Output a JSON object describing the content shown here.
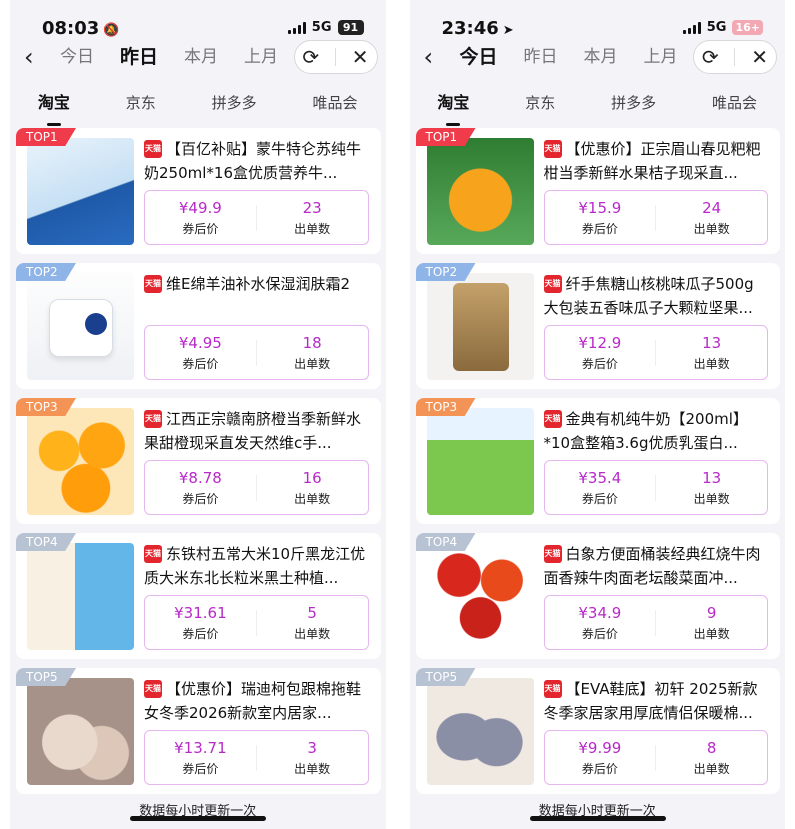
{
  "panels": [
    {
      "status": {
        "time": "08:03",
        "time_icon": "🔕",
        "network": "5G",
        "battery": "91",
        "battery_style": "dark"
      },
      "date_tabs": [
        "今日",
        "昨日",
        "本月",
        "上月"
      ],
      "active_date_tab": 1,
      "platform_tabs": [
        "淘宝",
        "京东",
        "拼多多",
        "唯品会"
      ],
      "active_platform_tab": 0,
      "items": [
        {
          "rank": "TOP1",
          "title": "【百亿补贴】蒙牛特仑苏纯牛奶250ml*16盒优质营养牛...",
          "price": "¥49.9",
          "price_label": "券后价",
          "orders": "23",
          "orders_label": "出单数",
          "image": "milk"
        },
        {
          "rank": "TOP2",
          "title": "维E绵羊油补水保湿润肤霜2",
          "price": "¥4.95",
          "price_label": "券后价",
          "orders": "18",
          "orders_label": "出单数",
          "image": "cream"
        },
        {
          "rank": "TOP3",
          "title": "江西正宗赣南脐橙当季新鲜水果甜橙现采直发天然维c手...",
          "price": "¥8.78",
          "price_label": "券后价",
          "orders": "16",
          "orders_label": "出单数",
          "image": "orange"
        },
        {
          "rank": "TOP4",
          "title": "东铁村五常大米10斤黑龙江优质大米东北长粒米黑土种植...",
          "price": "¥31.61",
          "price_label": "券后价",
          "orders": "5",
          "orders_label": "出单数",
          "image": "rice"
        },
        {
          "rank": "TOP5",
          "title": "【优惠价】瑞迪柯包跟棉拖鞋女冬季2026新款室内居家...",
          "price": "¥13.71",
          "price_label": "券后价",
          "orders": "3",
          "orders_label": "出单数",
          "image": "slipper"
        }
      ],
      "footer": "数据每小时更新一次"
    },
    {
      "status": {
        "time": "23:46",
        "time_icon": "➤",
        "network": "5G",
        "battery": "16+",
        "battery_style": "pink"
      },
      "date_tabs": [
        "今日",
        "昨日",
        "本月",
        "上月"
      ],
      "active_date_tab": 0,
      "platform_tabs": [
        "淘宝",
        "京东",
        "拼多多",
        "唯品会"
      ],
      "active_platform_tab": 0,
      "items": [
        {
          "rank": "TOP1",
          "title": "【优惠价】正宗眉山春见粑粑柑当季新鲜水果桔子现采直...",
          "price": "¥15.9",
          "price_label": "券后价",
          "orders": "24",
          "orders_label": "出单数",
          "image": "tangerine"
        },
        {
          "rank": "TOP2",
          "title": "纤手焦糖山核桃味瓜子500g大包装五香味瓜子大颗粒坚果...",
          "price": "¥12.9",
          "price_label": "券后价",
          "orders": "13",
          "orders_label": "出单数",
          "image": "seeds"
        },
        {
          "rank": "TOP3",
          "title": "金典有机纯牛奶【200ml】*10盒整箱3.6g优质乳蛋白...",
          "price": "¥35.4",
          "price_label": "券后价",
          "orders": "13",
          "orders_label": "出单数",
          "image": "organic"
        },
        {
          "rank": "TOP4",
          "title": "白象方便面桶装经典红烧牛肉面香辣牛肉面老坛酸菜面冲...",
          "price": "¥34.9",
          "price_label": "券后价",
          "orders": "9",
          "orders_label": "出单数",
          "image": "noodle"
        },
        {
          "rank": "TOP5",
          "title": "【EVA鞋底】初轩 2025新款冬季家居家用厚底情侣保暖棉...",
          "price": "¥9.99",
          "price_label": "券后价",
          "orders": "8",
          "orders_label": "出单数",
          "image": "shoes"
        }
      ],
      "footer": "数据每小时更新一次"
    }
  ],
  "icons": {
    "back": "chevron-left-icon",
    "refresh": "refresh-icon",
    "close": "close-icon",
    "tmall": "tmall-icon"
  },
  "tmall_badge": "天猫",
  "colors": {
    "accent": "#b829c9",
    "top1": "#ef3b4a",
    "top2": "#8fb4e8",
    "top3": "#f39456",
    "top45": "#b7c2d3",
    "tmall": "#e3262e"
  }
}
